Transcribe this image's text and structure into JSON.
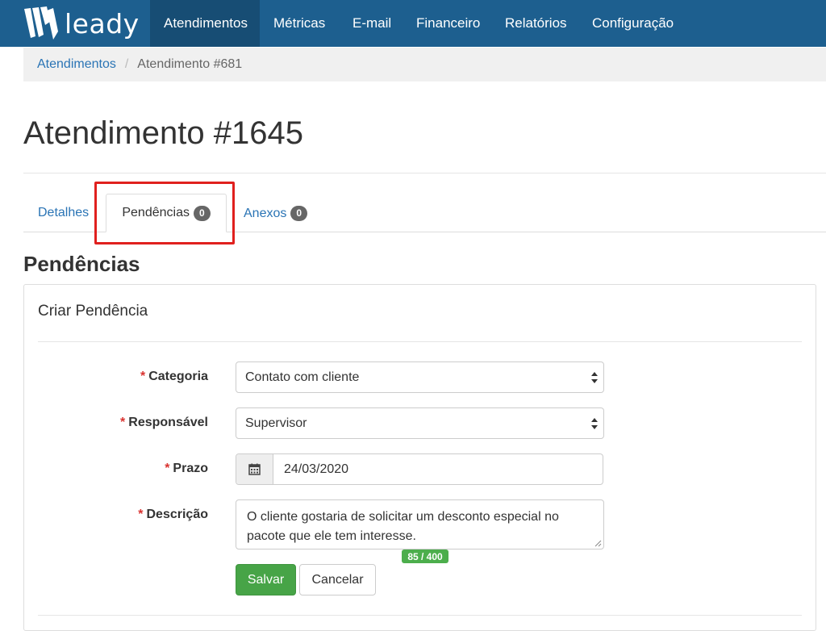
{
  "brand": {
    "name": "leady",
    "icon": "leady-logo-icon"
  },
  "nav": {
    "items": [
      {
        "label": "Atendimentos",
        "active": true
      },
      {
        "label": "Métricas"
      },
      {
        "label": "E-mail"
      },
      {
        "label": "Financeiro"
      },
      {
        "label": "Relatórios"
      },
      {
        "label": "Configuração"
      }
    ]
  },
  "breadcrumb": {
    "root": "Atendimentos",
    "separator": "/",
    "current": "Atendimento #681"
  },
  "page": {
    "title": "Atendimento #1645"
  },
  "tabs": [
    {
      "label": "Detalhes"
    },
    {
      "label": "Pendências",
      "badge": "0",
      "active": true
    },
    {
      "label": "Anexos",
      "badge": "0"
    }
  ],
  "section": {
    "title": "Pendências"
  },
  "panel": {
    "title": "Criar Pendência"
  },
  "form": {
    "required_mark": "*",
    "categoria": {
      "label": "Categoria",
      "value": "Contato com cliente"
    },
    "responsavel": {
      "label": "Responsável",
      "value": "Supervisor"
    },
    "prazo": {
      "label": "Prazo",
      "value": "24/03/2020",
      "icon": "calendar-icon"
    },
    "descricao": {
      "label": "Descrição",
      "value": "O cliente gostaria de solicitar um desconto especial no pacote que ele tem interesse.",
      "counter": "85 / 400"
    },
    "save_label": "Salvar",
    "cancel_label": "Cancelar"
  },
  "colors": {
    "nav_bg": "#1d5f8f",
    "nav_active": "#174d74",
    "link": "#2a74b5",
    "success": "#47a447",
    "required": "#d9322f",
    "highlight": "#e0201e"
  }
}
